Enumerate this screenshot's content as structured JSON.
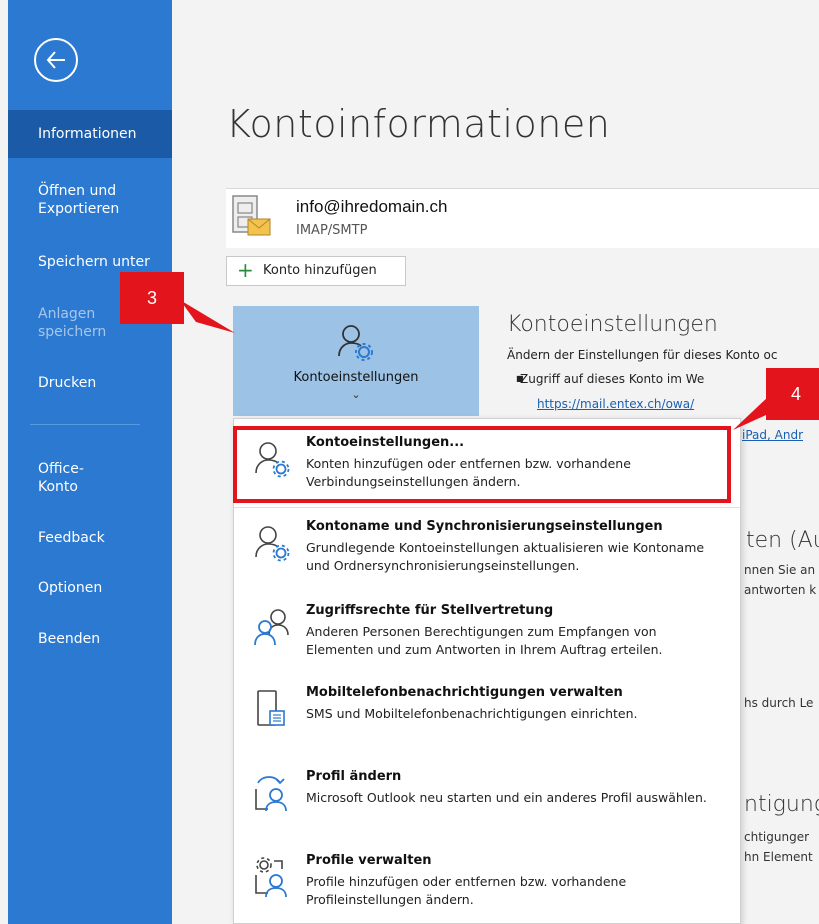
{
  "sidebar": {
    "items": [
      {
        "label": "Informationen",
        "active": true,
        "disabled": false
      },
      {
        "label": "Öffnen und Exportieren",
        "active": false,
        "disabled": false
      },
      {
        "label": "Speichern unter",
        "active": false,
        "disabled": false
      },
      {
        "label": "Anlagen speichern",
        "active": false,
        "disabled": true
      },
      {
        "label": "Drucken",
        "active": false,
        "disabled": false
      },
      {
        "label": "Office-Konto",
        "active": false,
        "disabled": false
      },
      {
        "label": "Feedback",
        "active": false,
        "disabled": false
      },
      {
        "label": "Optionen",
        "active": false,
        "disabled": false
      },
      {
        "label": "Beenden",
        "active": false,
        "disabled": false
      }
    ]
  },
  "page": {
    "title": "Kontoinformationen"
  },
  "account": {
    "email": "info@ihredomain.ch",
    "type": "IMAP/SMTP"
  },
  "add_account": {
    "label": "Konto hinzufügen"
  },
  "settings_tile": {
    "label": "Kontoeinstellungen",
    "caret": "⌄"
  },
  "section": {
    "title": "Kontoeinstellungen",
    "desc": "Ändern der Einstellungen für dieses Konto oc",
    "bullet": "Zugriff auf dieses Konto im We",
    "link": "https://mail.entex.ch/owa/",
    "link2": "iPad, Andr"
  },
  "background_fragments": {
    "a": "ten (Au",
    "b": "nnen Sie an",
    "c": "antworten k",
    "d": "hs durch Le",
    "e": "ntigung",
    "f": "chtigunger",
    "g": "hn Element"
  },
  "menu": {
    "items": [
      {
        "title": "Kontoeinstellungen...",
        "desc": "Konten hinzufügen oder entfernen bzw. vorhandene Verbindungseinstellungen ändern.",
        "icon": "account-gear-icon"
      },
      {
        "title": "Kontoname und Synchronisierungseinstellungen",
        "desc": "Grundlegende Kontoeinstellungen aktualisieren wie Kontoname und Ordnersynchronisierungseinstellungen.",
        "icon": "account-gear-icon"
      },
      {
        "title": "Zugriffsrechte für Stellvertretung",
        "desc": "Anderen Personen Berechtigungen zum Empfangen von Elementen und zum Antworten in Ihrem Auftrag erteilen.",
        "icon": "delegate-users-icon"
      },
      {
        "title": "Mobiltelefonbenachrichtigungen verwalten",
        "desc": "SMS und Mobiltelefonbenachrichtigungen einrichten.",
        "icon": "mobile-phone-icon"
      },
      {
        "title": "Profil ändern",
        "desc": "Microsoft Outlook neu starten und ein anderes Profil auswählen.",
        "icon": "change-profile-icon"
      },
      {
        "title": "Profile verwalten",
        "desc": "Profile hinzufügen oder entfernen bzw. vorhandene Profileinstellungen ändern.",
        "icon": "manage-profiles-icon"
      }
    ]
  },
  "callouts": {
    "three": "3",
    "four": "4"
  },
  "colors": {
    "sidebar": "#2b79d0",
    "sidebar_active": "#1a5aa6",
    "callout": "#e4141c",
    "tile": "#9cc3e6"
  }
}
